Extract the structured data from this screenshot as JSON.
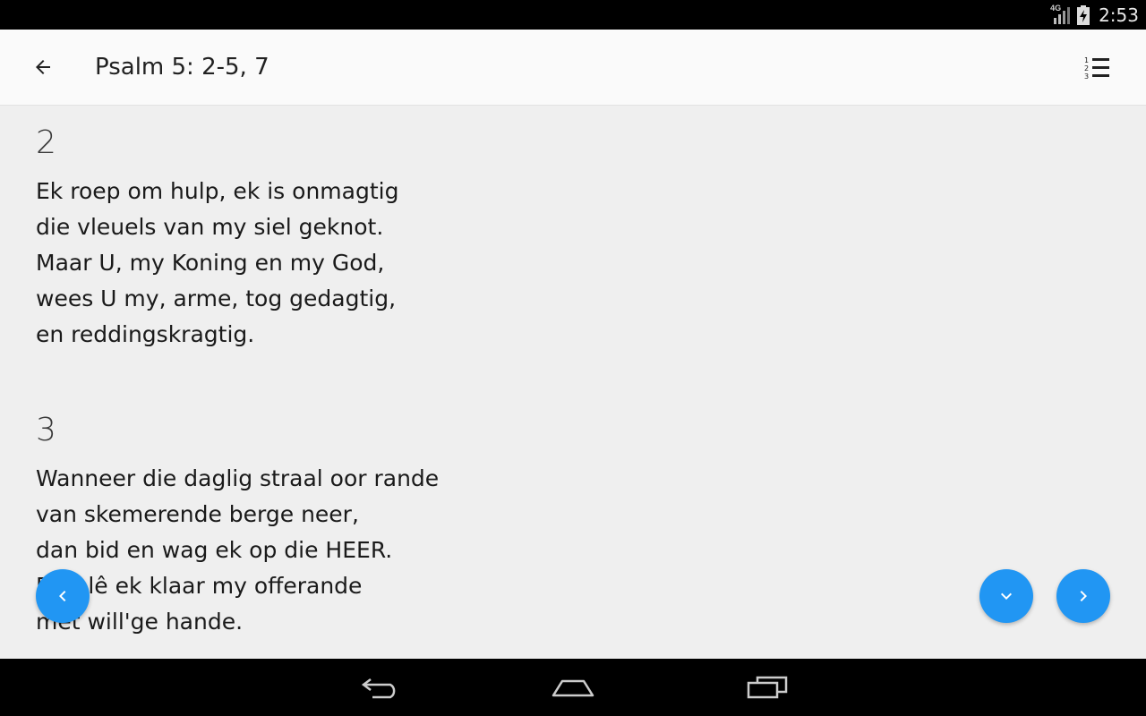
{
  "status_bar": {
    "time": "2:53",
    "network": "4G",
    "icons": [
      "signal-icon",
      "battery-charging-icon"
    ]
  },
  "app_bar": {
    "title": "Psalm 5: 2-5, 7",
    "icons": [
      "back-arrow-icon",
      "numbered-list-icon"
    ]
  },
  "verses": [
    {
      "number": "2",
      "lines": [
        "Ek roep om hulp, ek is onmagtig",
        "die vleuels van my siel geknot.",
        "Maar U, my Koning en my God,",
        "wees U my, arme, tog gedagtig,",
        "en reddingskragtig."
      ]
    },
    {
      "number": "3",
      "lines": [
        "Wanneer die daglig straal oor rande",
        "van skemerende berge neer,",
        "dan bid en wag ek op die HEER.",
        "Dan lê ek klaar my offerande",
        "met will'ge hande."
      ]
    }
  ],
  "fabs": {
    "previous_icon": "chevron-left-icon",
    "scroll_down_icon": "chevron-down-icon",
    "next_icon": "chevron-right-icon",
    "color": "#2196f3"
  },
  "nav_bar": {
    "icons": [
      "back-nav-icon",
      "home-nav-icon",
      "recents-nav-icon"
    ]
  }
}
